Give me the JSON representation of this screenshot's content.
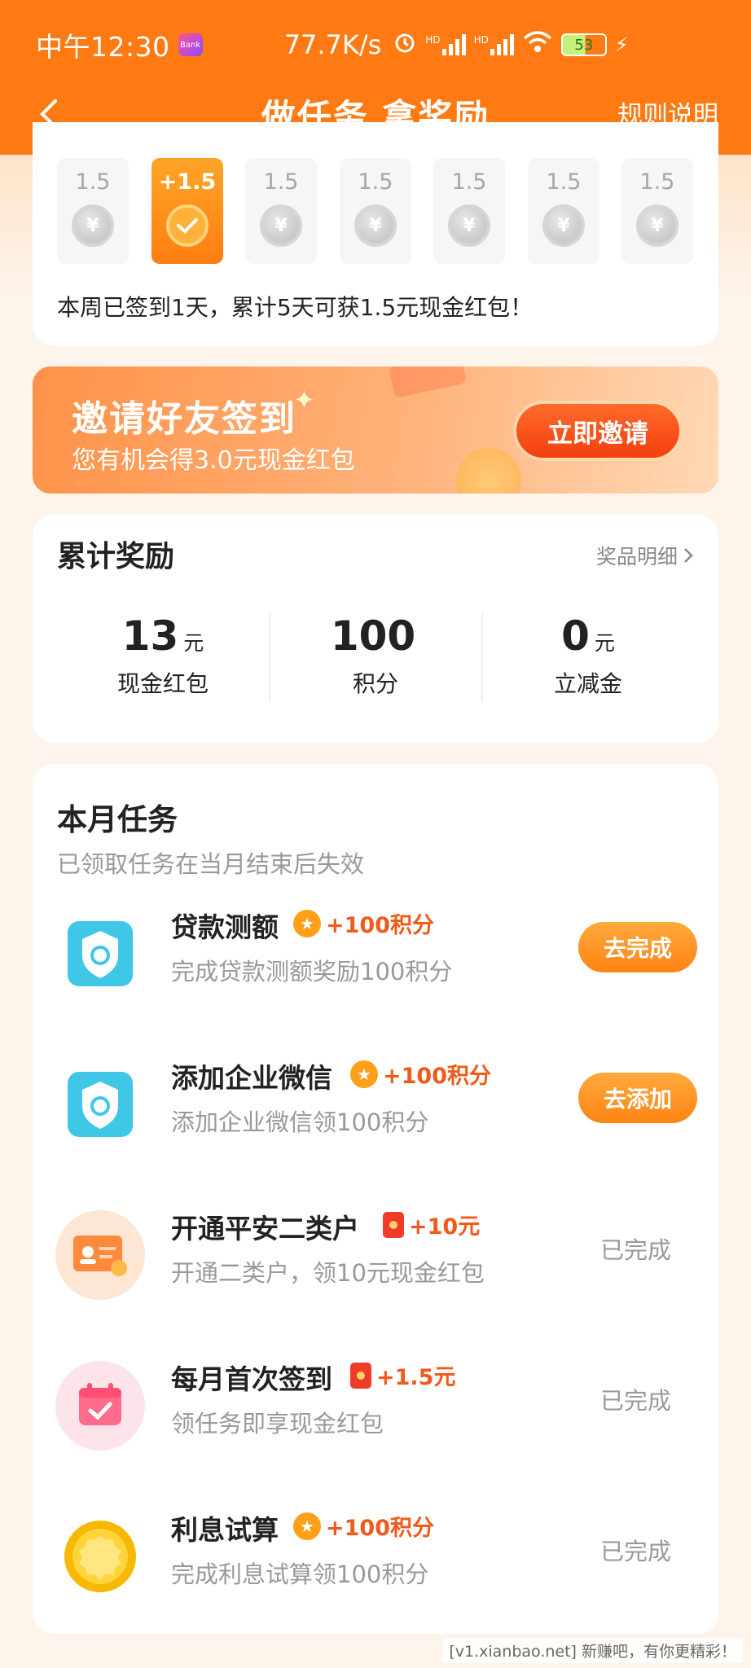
{
  "status_bar": {
    "time": "中午12:30",
    "app_badge": "Bank",
    "net_speed": "77.7K/s",
    "hd1": "HD",
    "hd2": "HD",
    "battery": "53"
  },
  "nav": {
    "title": "做任务 拿奖励",
    "rules_link": "规则说明"
  },
  "checkin": {
    "days": [
      {
        "amount": "1.5",
        "active": false
      },
      {
        "amount": "+1.5",
        "active": true
      },
      {
        "amount": "1.5",
        "active": false
      },
      {
        "amount": "1.5",
        "active": false
      },
      {
        "amount": "1.5",
        "active": false
      },
      {
        "amount": "1.5",
        "active": false
      },
      {
        "amount": "1.5",
        "active": false
      }
    ],
    "coin_symbol": "¥",
    "summary": "本周已签到1天，累计5天可获1.5元现金红包！"
  },
  "invite_banner": {
    "title": "邀请好友签到",
    "subtitle": "您有机会得3.0元现金红包",
    "button": "立即邀请"
  },
  "rewards": {
    "title": "累计奖励",
    "detail_link": "奖品明细",
    "items": [
      {
        "value": "13",
        "unit": "元",
        "label": "现金红包"
      },
      {
        "value": "100",
        "unit": "",
        "label": "积分"
      },
      {
        "value": "0",
        "unit": "元",
        "label": "立减金"
      }
    ]
  },
  "tasks": {
    "title": "本月任务",
    "subtitle": "已领取任务在当月结束后失效",
    "items": [
      {
        "name": "贷款测额",
        "reward": "+100积分",
        "desc": "完成贷款测额奖励100积分",
        "action": "去完成",
        "done": false,
        "icon": "shield-icon",
        "badge": "star"
      },
      {
        "name": "添加企业微信",
        "reward": "+100积分",
        "desc": "添加企业微信领100积分",
        "action": "去添加",
        "done": false,
        "icon": "shield-icon",
        "badge": "star"
      },
      {
        "name": "开通平安二类户",
        "reward": "+10元",
        "desc": "开通二类户，领10元现金红包",
        "action": "已完成",
        "done": true,
        "icon": "id-card-icon",
        "badge": "envelope"
      },
      {
        "name": "每月首次签到",
        "reward": "+1.5元",
        "desc": "领任务即享现金红包",
        "action": "已完成",
        "done": true,
        "icon": "calendar-check-icon",
        "badge": "envelope"
      },
      {
        "name": "利息试算",
        "reward": "+100积分",
        "desc": "完成利息试算领100积分",
        "action": "已完成",
        "done": true,
        "icon": "gold-coin-icon",
        "badge": "star"
      }
    ]
  },
  "watermark": "[v1.xianbao.net] 新赚吧，有你更精彩！",
  "colors": {
    "brand_orange": "#ff7a12",
    "reward_red": "#f05a1a",
    "muted_gray": "#999999"
  }
}
